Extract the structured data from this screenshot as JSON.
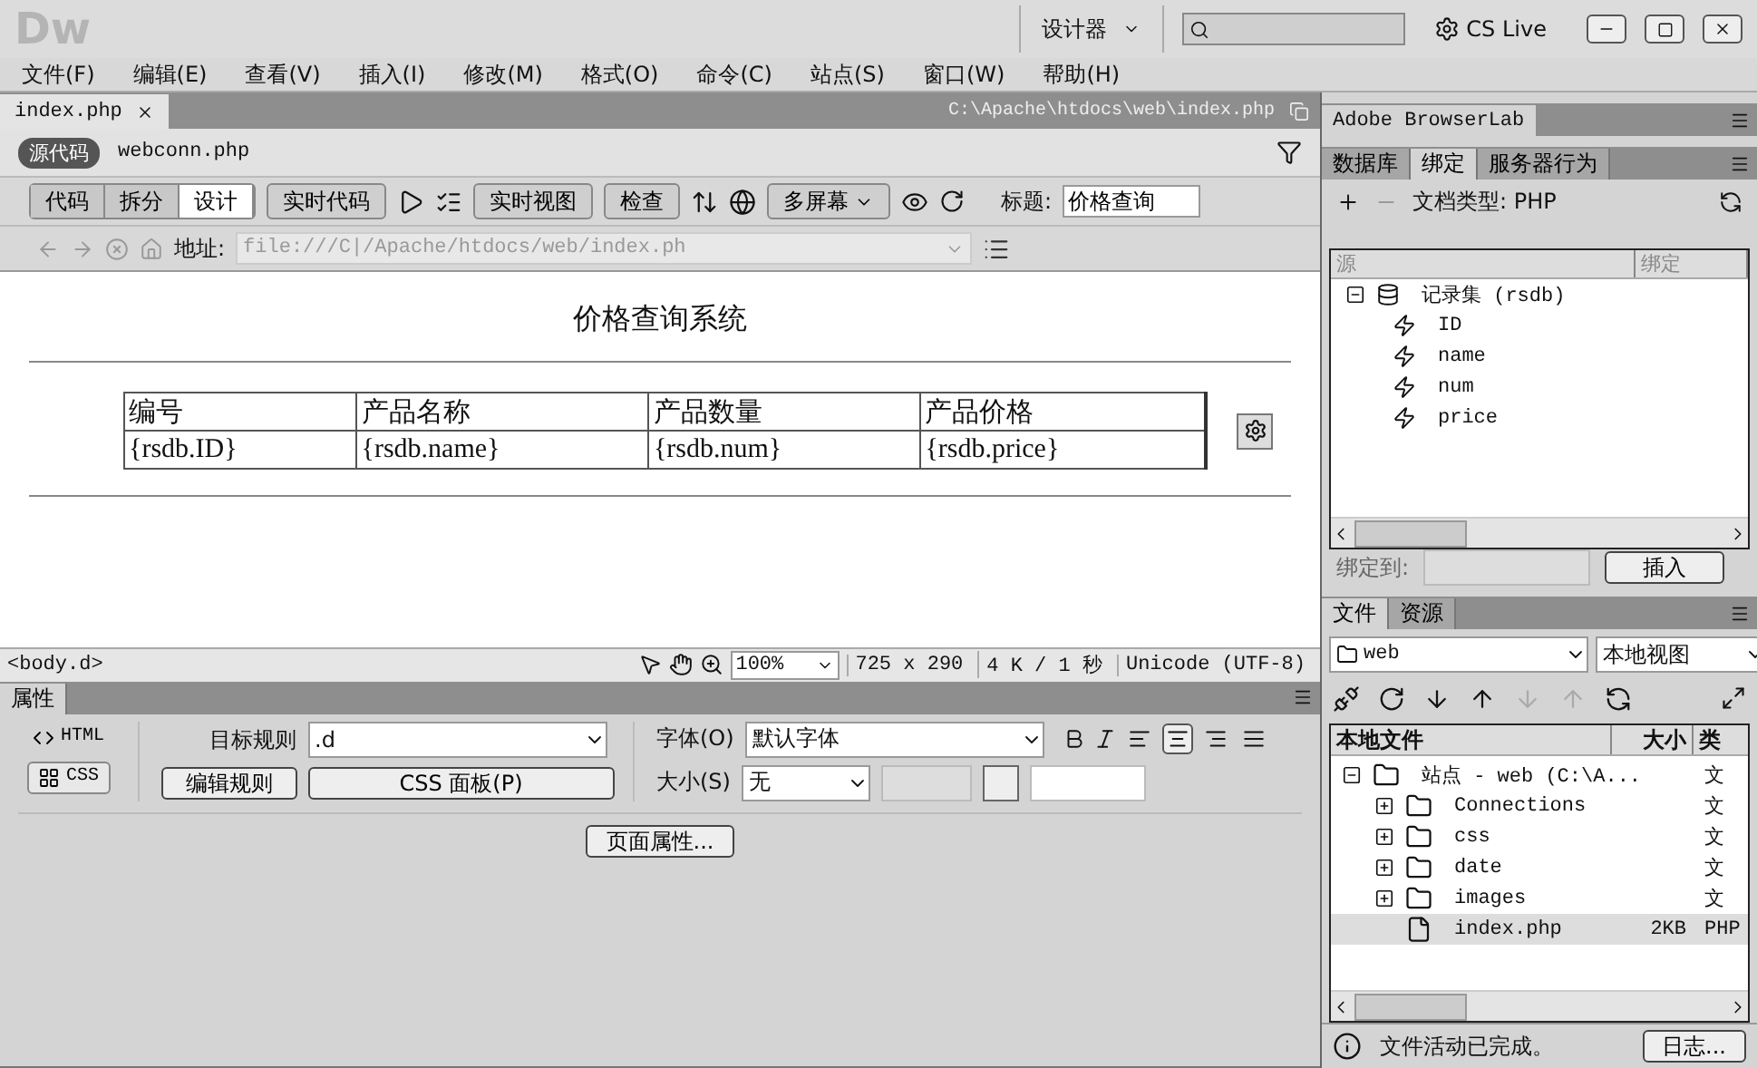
{
  "app": {
    "logo": "Dw",
    "workspace": "设计器",
    "cs_live": "CS Live"
  },
  "menu": [
    "文件(F)",
    "编辑(E)",
    "查看(V)",
    "插入(I)",
    "修改(M)",
    "格式(O)",
    "命令(C)",
    "站点(S)",
    "窗口(W)",
    "帮助(H)"
  ],
  "document": {
    "tabs": [
      {
        "label": "index.php",
        "selected": true
      }
    ],
    "path": "C:\\Apache\\htdocs\\web\\index.php",
    "related_files": [
      {
        "label": "源代码",
        "selected": true
      },
      {
        "label": "webconn.php",
        "selected": false
      }
    ]
  },
  "toolbar": {
    "views": [
      {
        "label": "代码",
        "selected": false
      },
      {
        "label": "拆分",
        "selected": false
      },
      {
        "label": "设计",
        "selected": true
      }
    ],
    "live_code": "实时代码",
    "live_view": "实时视图",
    "inspect": "检查",
    "multiscreen": "多屏幕",
    "title_label": "标题:",
    "title_value": "价格查询"
  },
  "address": {
    "label": "地址:",
    "value": "file:///C|/Apache/htdocs/web/index.ph"
  },
  "page": {
    "heading": "价格查询系统",
    "table": {
      "columns": [
        "编号",
        "产品名称",
        "产品数量",
        "产品价格"
      ],
      "rows": [
        [
          "{rsdb.ID}",
          "{rsdb.name}",
          "{rsdb.num}",
          "{rsdb.price}"
        ]
      ]
    }
  },
  "status_bar": {
    "tag": "<body.d>",
    "zoom": "100%",
    "size": "725 x 290",
    "download": "4 K / 1 秒",
    "encoding": "Unicode (UTF-8)"
  },
  "properties": {
    "title": "属性",
    "modes": [
      {
        "label": "HTML",
        "selected": false
      },
      {
        "label": "CSS",
        "selected": true
      }
    ],
    "target_rule_label": "目标规则",
    "target_rule": ".d",
    "edit_rule": "编辑规则",
    "css_panel": "CSS 面板(P)",
    "font_label": "字体(O)",
    "font": "默认字体",
    "size_label": "大小(S)",
    "size": "无",
    "align": [
      {
        "kind": "left",
        "selected": false
      },
      {
        "kind": "center",
        "selected": true
      },
      {
        "kind": "right",
        "selected": false
      },
      {
        "kind": "justify",
        "selected": false
      }
    ],
    "page_properties": "页面属性..."
  },
  "browserlab": {
    "title": "Adobe BrowserLab"
  },
  "bindings": {
    "tabs": [
      {
        "label": "数据库",
        "selected": false
      },
      {
        "label": "绑定",
        "selected": true
      },
      {
        "label": "服务器行为",
        "selected": false
      }
    ],
    "doc_type": "文档类型: PHP",
    "columns": [
      "源",
      "绑定"
    ],
    "tree": [
      {
        "label": "记录集 (rsdb)",
        "expanded": true,
        "children": [
          {
            "label": "ID"
          },
          {
            "label": "name"
          },
          {
            "label": "num"
          },
          {
            "label": "price"
          }
        ]
      }
    ],
    "bind_to": "绑定到:",
    "insert": "插入"
  },
  "files": {
    "tabs": [
      {
        "label": "文件",
        "selected": true
      },
      {
        "label": "资源",
        "selected": false
      }
    ],
    "site": "web",
    "view": "本地视图",
    "columns": [
      "本地文件",
      "大小",
      "类"
    ],
    "tree": [
      {
        "kind": "site",
        "name": "站点 - web (C:\\A...",
        "type": "文",
        "expanded": true,
        "selected": false,
        "children": [
          {
            "kind": "folder",
            "name": "Connections",
            "type": "文",
            "expanded": false,
            "selected": false
          },
          {
            "kind": "folder",
            "name": "css",
            "type": "文",
            "expanded": false,
            "selected": false
          },
          {
            "kind": "folder",
            "name": "date",
            "type": "文",
            "expanded": false,
            "selected": false
          },
          {
            "kind": "folder",
            "name": "images",
            "type": "文",
            "expanded": false,
            "selected": false
          },
          {
            "kind": "file",
            "name": "index.php",
            "size": "2KB",
            "type": "PHP",
            "selected": true
          }
        ]
      }
    ],
    "status": "文件活动已完成。",
    "log": "日志..."
  }
}
